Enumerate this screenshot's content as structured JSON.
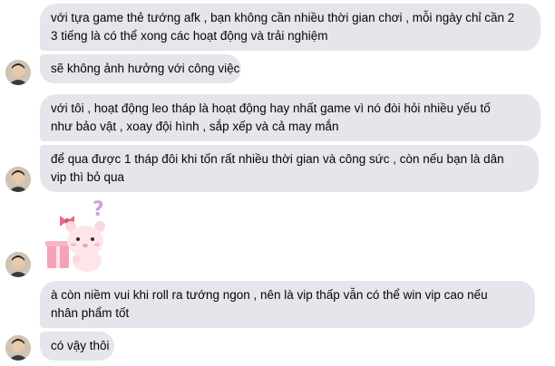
{
  "messages": [
    {
      "lines": [
        "với tựa game thẻ tướng afk , bạn không cần nhiều thời gian chơi , mỗi ngày chỉ cần 2",
        "3 tiếng là có thể xong các hoạt động và trải nghiệm"
      ]
    },
    {
      "lines": [
        "sẽ không ảnh hưởng với công việc"
      ]
    },
    {
      "lines": [
        "với tôi , hoạt động leo tháp là hoạt động hay nhất game vì nó đòi hỏi nhiều yếu tố",
        "như bảo vật , xoay đội hình , sắp xếp và cả may mắn"
      ]
    },
    {
      "lines": [
        "để qua được 1 tháp đôi khi tốn rất nhiều thời gian và công sức , còn nếu bạn là dân",
        "vip thì bỏ qua"
      ]
    },
    {
      "lines": [
        "à còn niềm vui khi roll ra tướng ngon , nên là vip thấp vẫn có thể win vip cao nếu",
        "nhân phẩm tốt"
      ]
    },
    {
      "lines": [
        "có vậy thôi"
      ]
    }
  ],
  "sticker": {
    "icon": "confused-bear-sticker-icon",
    "symbol": "?"
  },
  "avatar_icon": "user-avatar-icon",
  "colors": {
    "bubble": "#e4e6eb",
    "text": "#050505",
    "sticker_pink": "#f6b8c4"
  }
}
